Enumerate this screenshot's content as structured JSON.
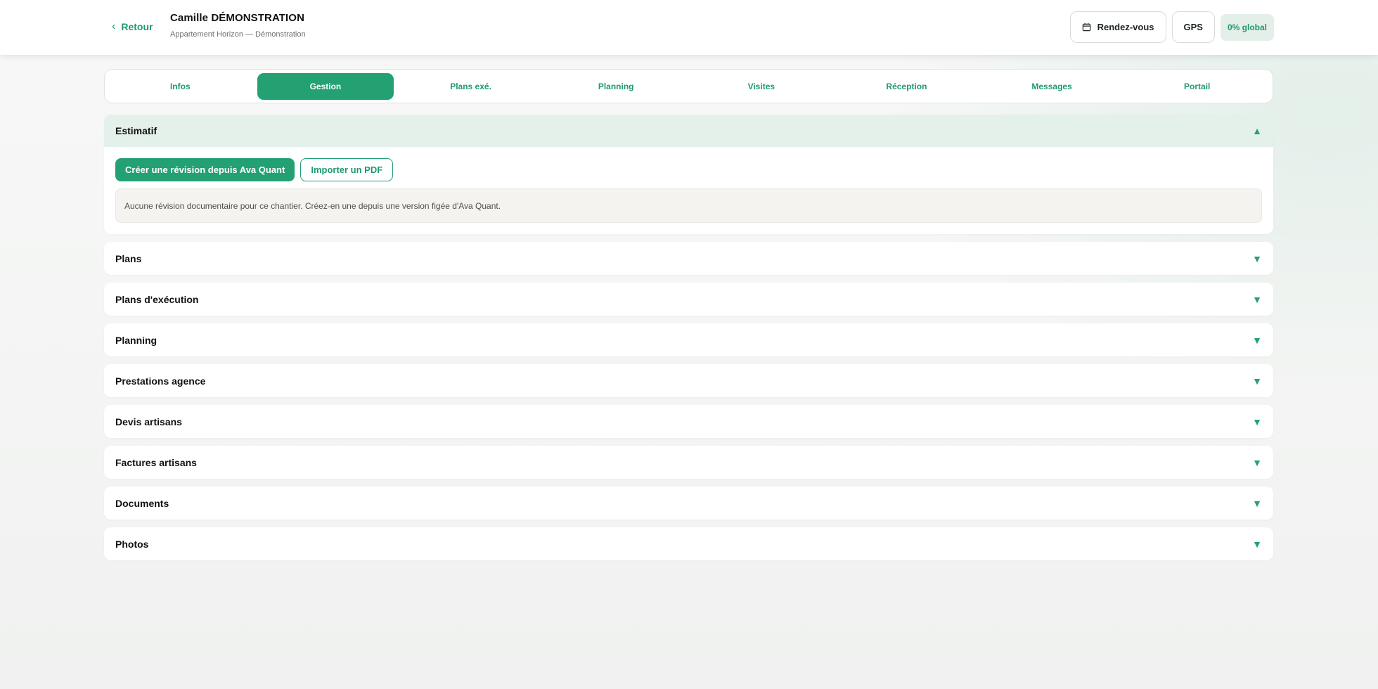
{
  "header": {
    "back_label": "Retour",
    "title": "Camille DÉMONSTRATION",
    "subtitle": "Appartement Horizon — Démonstration",
    "actions": {
      "rendezvous_label": "Rendez-vous",
      "gps_label": "GPS",
      "global_badge": "0% global"
    }
  },
  "tabs": [
    {
      "label": "Infos"
    },
    {
      "label": "Gestion",
      "active": true
    },
    {
      "label": "Plans exé."
    },
    {
      "label": "Planning"
    },
    {
      "label": "Visites"
    },
    {
      "label": "Réception"
    },
    {
      "label": "Messages"
    },
    {
      "label": "Portail"
    }
  ],
  "estimatif": {
    "title": "Estimatif",
    "create_label": "Créer une révision depuis Ava Quant",
    "import_label": "Importer un PDF",
    "empty_notice": "Aucune révision documentaire pour ce chantier. Créez-en une depuis une version figée d'Ava Quant."
  },
  "sections": [
    {
      "title": "Plans"
    },
    {
      "title": "Plans d'exécution"
    },
    {
      "title": "Planning"
    },
    {
      "title": "Prestations agence"
    },
    {
      "title": "Devis artisans"
    },
    {
      "title": "Factures artisans"
    },
    {
      "title": "Documents"
    },
    {
      "title": "Photos"
    }
  ],
  "icons": {
    "caret_up": "caret-up-icon",
    "caret_down": "caret-down-icon",
    "calendar": "calendar-icon",
    "back": "chevron-left-icon"
  },
  "colors": {
    "accent": "#23a173",
    "accent_text": "#1f9a6d",
    "open_section_bg": "#e4f0ea"
  }
}
